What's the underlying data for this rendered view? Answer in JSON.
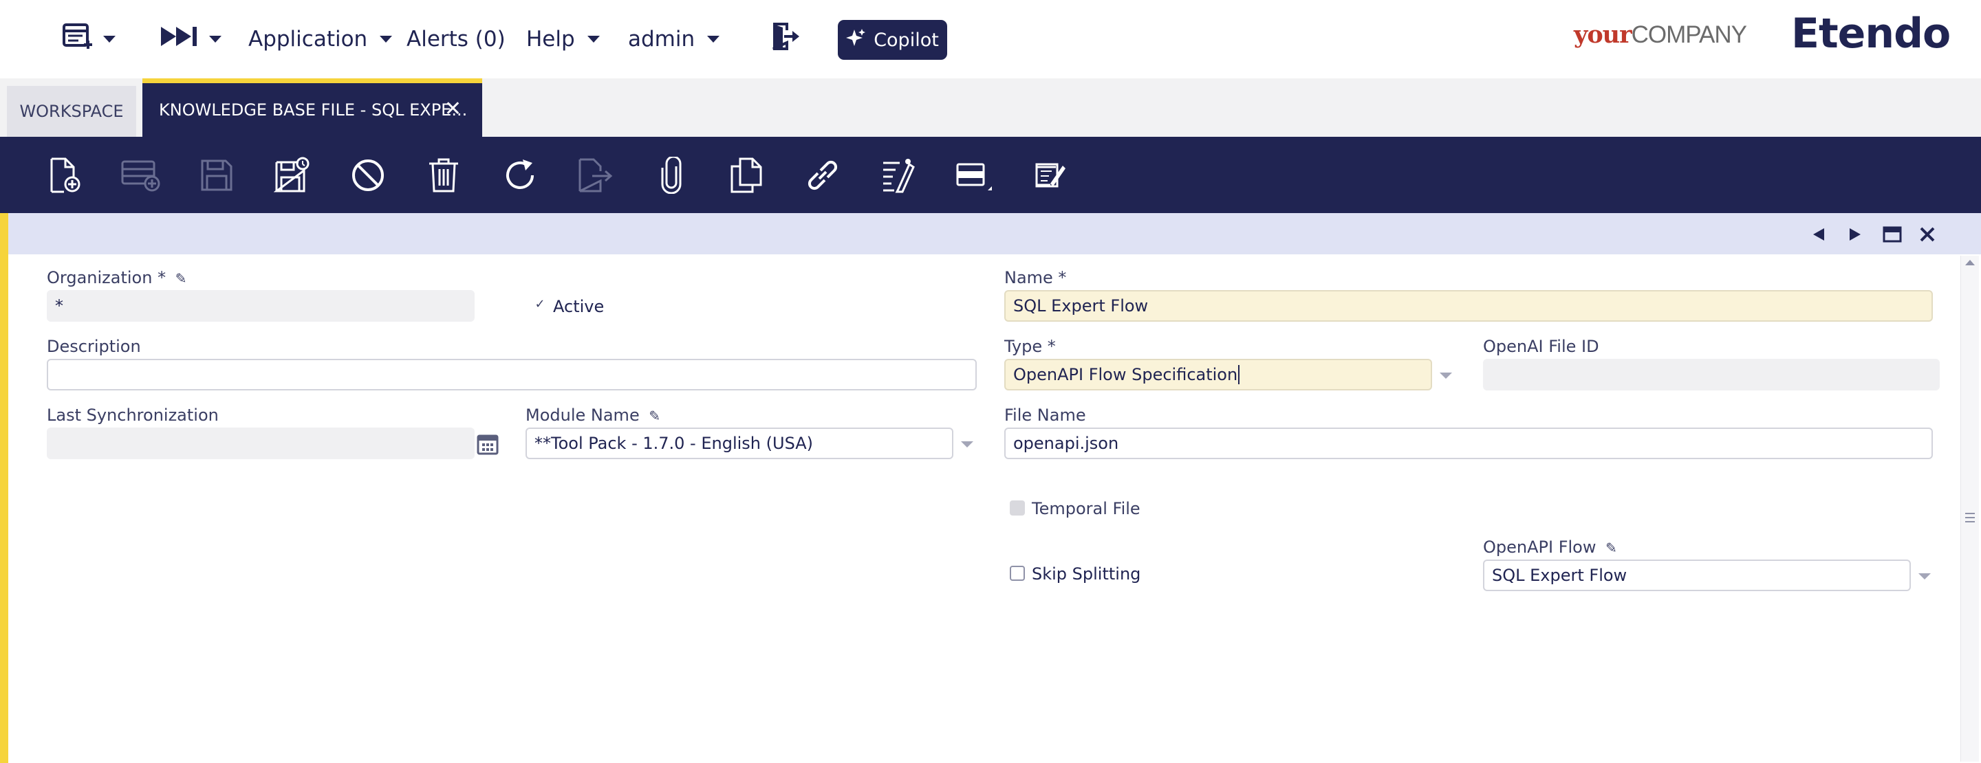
{
  "nav": {
    "application": "Application",
    "alerts": "Alerts (0)",
    "help": "Help",
    "user": "admin",
    "copilot": "Copilot"
  },
  "brand": {
    "your": "your",
    "company": "COMPANY",
    "etendo": "Etendo"
  },
  "tabs": {
    "workspace": "WORKSPACE",
    "active": "KNOWLEDGE BASE FILE - SQL EXPE..."
  },
  "form": {
    "organization": {
      "label": "Organization *",
      "value": "*"
    },
    "active": {
      "label": "Active",
      "checked": true
    },
    "name": {
      "label": "Name *",
      "value": "SQL Expert Flow"
    },
    "description": {
      "label": "Description",
      "value": ""
    },
    "type": {
      "label": "Type *",
      "value": "OpenAPI Flow Specification"
    },
    "openai_file_id": {
      "label": "OpenAI File ID",
      "value": ""
    },
    "last_sync": {
      "label": "Last Synchronization",
      "value": ""
    },
    "module_name": {
      "label": "Module Name",
      "value": "**Tool Pack - 1.7.0 - English (USA)"
    },
    "file_name": {
      "label": "File Name",
      "value": "openapi.json"
    },
    "temporal_file": {
      "label": "Temporal File",
      "checked": false
    },
    "skip_splitting": {
      "label": "Skip Splitting",
      "checked": false
    },
    "openapi_flow": {
      "label": "OpenAPI Flow",
      "value": "SQL Expert Flow"
    }
  },
  "colors": {
    "navy": "#202452",
    "accent_yellow": "#f6d43c",
    "form_bar": "#dfe2f4",
    "required_field": "#faf3d9",
    "brand_your": "#c0392b"
  },
  "toolbar_icons": [
    "new-document-icon",
    "new-row-icon",
    "save-icon",
    "save-close-icon",
    "undo-icon",
    "delete-icon",
    "refresh-icon",
    "export-icon",
    "attachment-icon",
    "copy-record-icon",
    "link-icon",
    "audit-trail-icon",
    "grid-view-icon",
    "notes-icon"
  ]
}
